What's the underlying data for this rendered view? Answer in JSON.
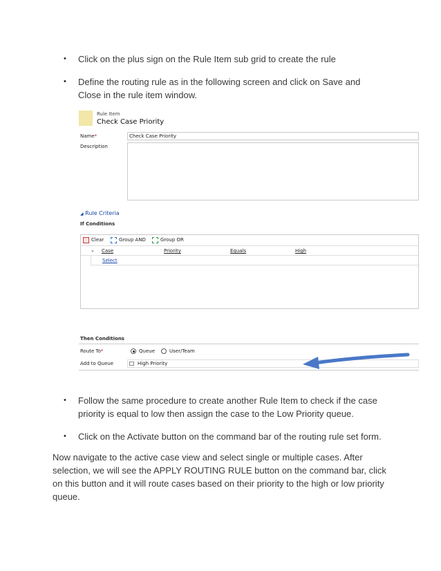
{
  "bullets_top": [
    "Click on the plus sign on the Rule Item sub grid to create the rule",
    "Define the routing rule as in the following screen and click on Save and Close in the rule item window."
  ],
  "bullets_bottom": [
    "Follow the same procedure to create another Rule Item to check if the case priority is equal to low then assign the case to the Low Priority queue.",
    "Click on the Activate button on the command bar of the routing rule set form."
  ],
  "paragraph": "Now navigate to the active case view and select single or multiple cases. After selection, we will see the APPLY ROUTING RULE button on the command bar, click on this button and it will route cases based on their priority to the high or low priority queue.",
  "bullet_glyph": "•",
  "shot": {
    "entity_label": "Rule Item",
    "entity_title": "Check Case Priority",
    "name_label": "Name",
    "required_mark": "*",
    "name_value": "Check Case Priority",
    "description_label": "Description",
    "rule_criteria": "Rule Criteria",
    "if_conditions": "If Conditions",
    "toolbar": {
      "clear": "Clear",
      "group_and": "Group AND",
      "group_or": "Group OR"
    },
    "condition": {
      "field": "Case",
      "attribute": "Priority",
      "operator": "Equals",
      "value": "High"
    },
    "select_link": "Select",
    "then_conditions": "Then Conditions",
    "route_to_label": "Route To",
    "route_options": [
      "Queue",
      "User/Team"
    ],
    "route_selected": "Queue",
    "add_to_queue_label": "Add to Queue",
    "queue_value": "High Priority",
    "accent_color": "#4a78c8",
    "required_color": "#d0021b"
  }
}
